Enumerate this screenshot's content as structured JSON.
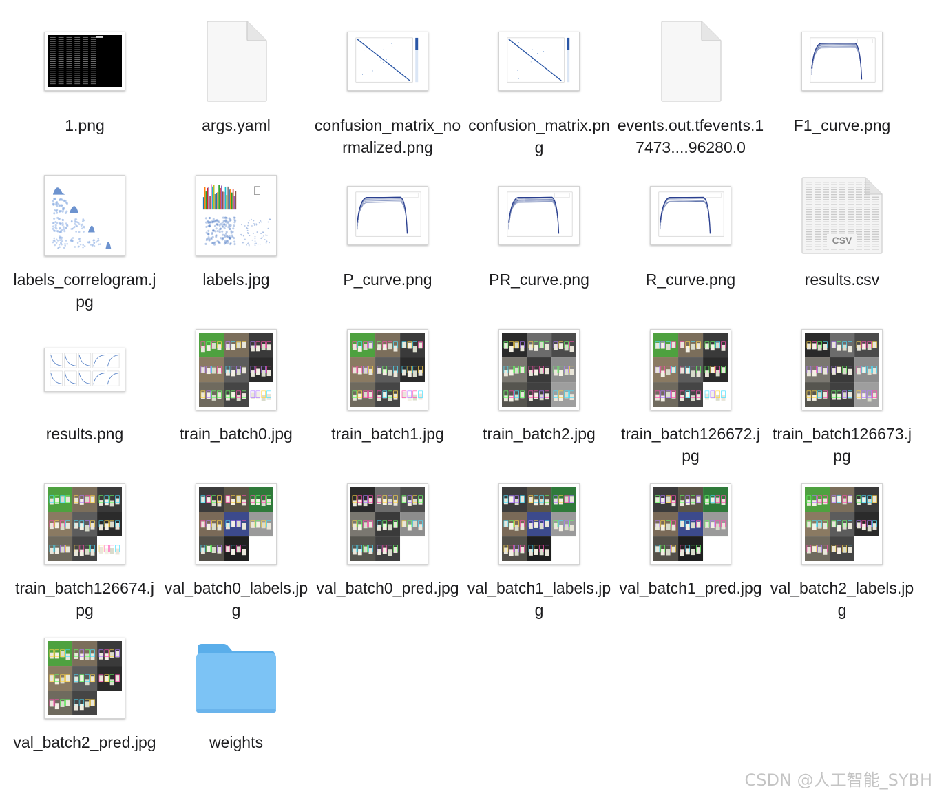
{
  "files": [
    {
      "name": "1.png",
      "kind": "image",
      "preview": "terminal-preview"
    },
    {
      "name": "args.yaml",
      "kind": "document",
      "preview": "blank-document"
    },
    {
      "name": "confusion_matrix_normalized.png",
      "kind": "image",
      "preview": "matrix-preview"
    },
    {
      "name": "confusion_matrix.png",
      "kind": "image",
      "preview": "matrix-preview"
    },
    {
      "name": "events.out.tfevents.17473....96280.0",
      "kind": "document",
      "preview": "blank-document"
    },
    {
      "name": "F1_curve.png",
      "kind": "image",
      "preview": "curve-preview"
    },
    {
      "name": "labels_correlogram.jpg",
      "kind": "image",
      "preview": "correlogram-preview"
    },
    {
      "name": "labels.jpg",
      "kind": "image",
      "preview": "labels-histogram-preview"
    },
    {
      "name": "P_curve.png",
      "kind": "image",
      "preview": "curve-preview"
    },
    {
      "name": "PR_curve.png",
      "kind": "image",
      "preview": "curve-preview"
    },
    {
      "name": "R_curve.png",
      "kind": "image",
      "preview": "curve-preview"
    },
    {
      "name": "results.csv",
      "kind": "spreadsheet",
      "preview": "csv-document",
      "badge": "CSV"
    },
    {
      "name": "results.png",
      "kind": "image",
      "preview": "results-grid-preview"
    },
    {
      "name": "train_batch0.jpg",
      "kind": "image",
      "preview": "photo-mosaic-preview"
    },
    {
      "name": "train_batch1.jpg",
      "kind": "image",
      "preview": "photo-mosaic-preview"
    },
    {
      "name": "train_batch2.jpg",
      "kind": "image",
      "preview": "photo-mosaic-preview"
    },
    {
      "name": "train_batch126672.jpg",
      "kind": "image",
      "preview": "photo-mosaic-preview"
    },
    {
      "name": "train_batch126673.jpg",
      "kind": "image",
      "preview": "photo-mosaic-preview"
    },
    {
      "name": "train_batch126674.jpg",
      "kind": "image",
      "preview": "photo-mosaic-preview"
    },
    {
      "name": "val_batch0_labels.jpg",
      "kind": "image",
      "preview": "photo-mosaic-preview"
    },
    {
      "name": "val_batch0_pred.jpg",
      "kind": "image",
      "preview": "photo-mosaic-preview"
    },
    {
      "name": "val_batch1_labels.jpg",
      "kind": "image",
      "preview": "photo-mosaic-preview"
    },
    {
      "name": "val_batch1_pred.jpg",
      "kind": "image",
      "preview": "photo-mosaic-preview"
    },
    {
      "name": "val_batch2_labels.jpg",
      "kind": "image",
      "preview": "photo-mosaic-preview"
    },
    {
      "name": "val_batch2_pred.jpg",
      "kind": "image",
      "preview": "photo-mosaic-preview"
    },
    {
      "name": "weights",
      "kind": "folder",
      "preview": "folder-icon"
    }
  ],
  "watermark": "CSDN @人工智能_SYBH",
  "colors": {
    "folder_body": "#7cc3f5",
    "folder_tab": "#5aaeea",
    "icon_stroke": "#2a3f8f",
    "matrix_line": "#2b57a6"
  }
}
